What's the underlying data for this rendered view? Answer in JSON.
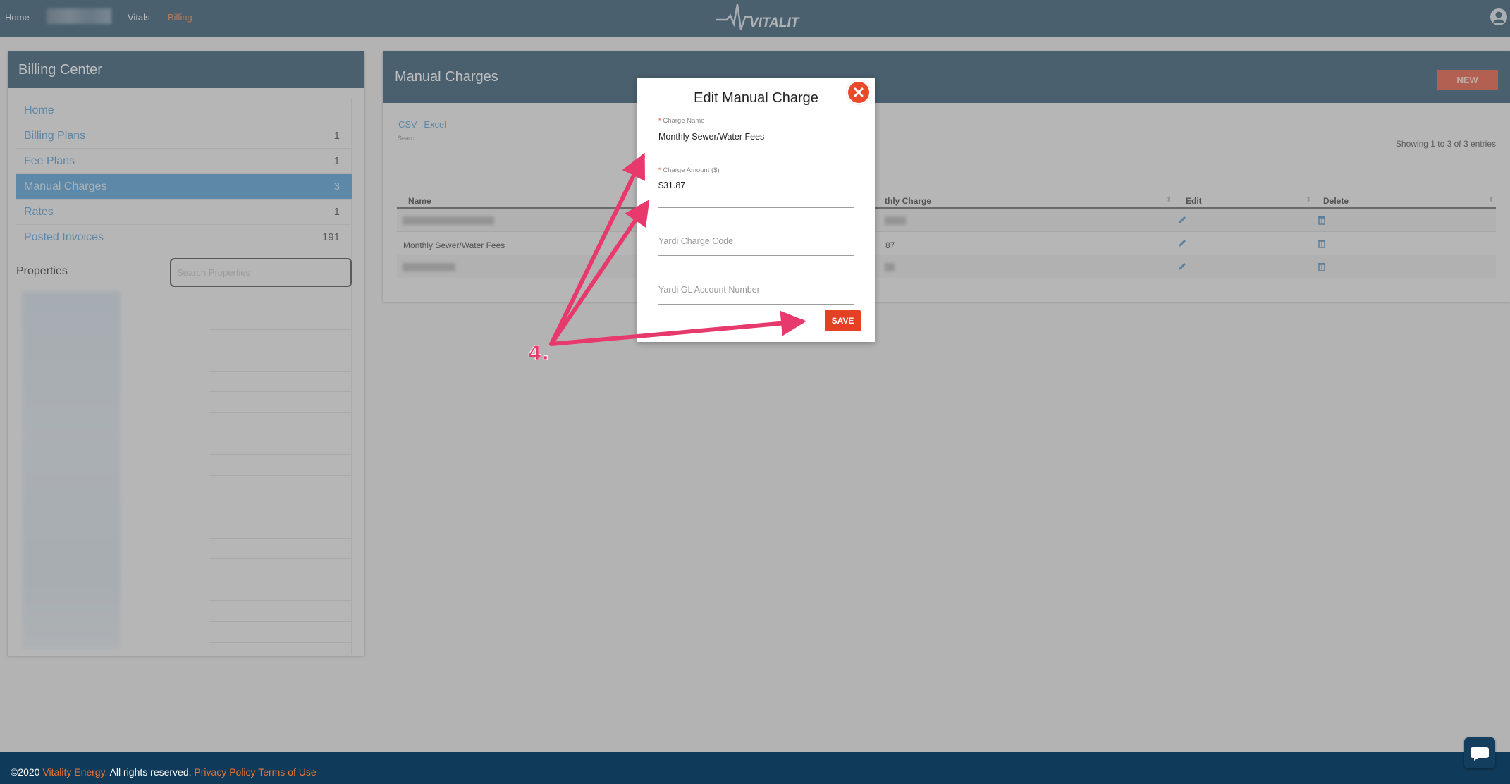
{
  "nav": {
    "home": "Home",
    "vitals": "Vitals",
    "billing": "Billing",
    "logo_text": "VITALITY",
    "accent": "#e87432"
  },
  "sidebar": {
    "title": "Billing Center",
    "items": [
      {
        "label": "Home",
        "count": ""
      },
      {
        "label": "Billing Plans",
        "count": "1"
      },
      {
        "label": "Fee Plans",
        "count": "1"
      },
      {
        "label": "Manual Charges",
        "count": "3"
      },
      {
        "label": "Rates",
        "count": "1"
      },
      {
        "label": "Posted Invoices",
        "count": "191"
      }
    ],
    "properties_label": "Properties",
    "search_placeholder": "Search Properties"
  },
  "main": {
    "title": "Manual Charges",
    "new_label": "NEW",
    "export": [
      "CSV",
      "Excel"
    ],
    "search_label": "Search:",
    "showing": "Showing 1 to 3 of 3 entries",
    "columns": [
      "Name",
      "thly Charge",
      "Edit",
      "Delete"
    ],
    "rows": [
      {
        "name": "",
        "charge": ""
      },
      {
        "name": "Monthly Sewer/Water Fees",
        "charge": "87"
      },
      {
        "name": "",
        "charge": ""
      }
    ]
  },
  "modal": {
    "title": "Edit Manual Charge",
    "charge_name_label": "Charge Name",
    "charge_name_value": "Monthly Sewer/Water Fees",
    "charge_amount_label": "Charge Amount ($)",
    "charge_amount_value": "$31.87",
    "yardi_code_placeholder": "Yardi Charge Code",
    "yardi_gl_placeholder": "Yardi GL Account Number",
    "save_label": "SAVE"
  },
  "annotation": {
    "step": "4."
  },
  "footer": {
    "copyright": "©2020",
    "company": "Vitality Energy.",
    "rights": "All rights reserved.",
    "privacy": "Privacy Policy",
    "terms": "Terms of Use"
  },
  "colors": {
    "header_blue": "#14405f",
    "link_blue": "#3a8cc9",
    "active_blue": "#3b91cf",
    "danger_orange": "#e44124",
    "annotation_pink": "#e8396c"
  },
  "icons": [
    "user-icon",
    "pencil-icon",
    "trash-icon",
    "close-icon",
    "chat-icon",
    "vitality-logo"
  ]
}
